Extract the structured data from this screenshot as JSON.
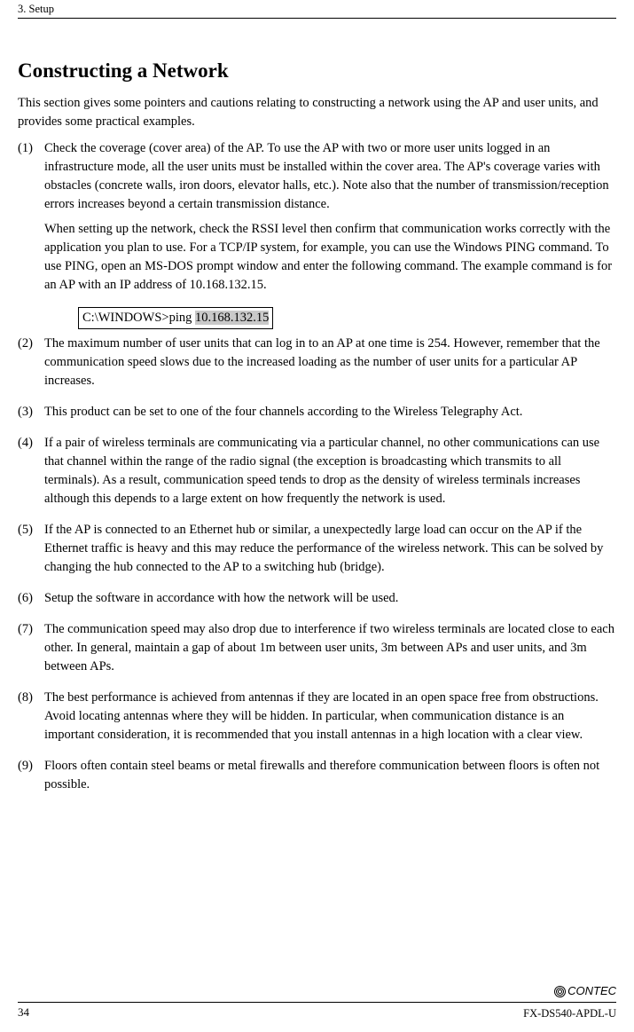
{
  "header": {
    "section": "3. Setup"
  },
  "heading": "Constructing a Network",
  "intro": "This section gives some pointers and cautions relating to constructing a network using the AP and user units, and provides some practical examples.",
  "items": [
    {
      "num": "(1)",
      "paras": [
        "Check the coverage (cover area) of the AP.  To use the AP with two or more user units logged in an infrastructure mode, all the user units must be installed within the cover area.  The AP's coverage varies with obstacles (concrete walls, iron doors, elevator halls, etc.).  Note also that the number of transmission/reception errors increases beyond a certain transmission distance.",
        "When setting up the network, check the RSSI level then confirm that communication works correctly with the application you plan to use.  For a TCP/IP system, for example, you can use the Windows PING command.  To use PING, open an MS-DOS prompt window and enter the following command.  The example command is for an AP with an IP address of 10.168.132.15."
      ]
    },
    {
      "num": "(2)",
      "paras": [
        "The maximum number of user units that can log in to an AP at one time is 254.  However, remember that the communication speed slows due to the increased loading as the number of user units for a particular AP increases."
      ]
    },
    {
      "num": "(3)",
      "paras": [
        "This product can be set to one of the four channels according to the Wireless Telegraphy Act."
      ]
    },
    {
      "num": "(4)",
      "paras": [
        "If a pair of wireless terminals are communicating via a particular channel, no other communications can use that channel within the range of the radio signal (the exception is broadcasting which transmits to all terminals).  As a result, communication speed tends to drop as the density of wireless terminals increases although this depends to a large extent on how frequently the network is used."
      ]
    },
    {
      "num": "(5)",
      "paras": [
        "If the AP is connected to an Ethernet hub or similar, a unexpectedly large load can occur on the AP if the Ethernet traffic is heavy and this may reduce the performance of the wireless network.  This can be solved by changing the hub connected to the AP to a switching hub (bridge)."
      ]
    },
    {
      "num": "(6)",
      "paras": [
        "Setup the software in accordance with how the network will be used."
      ]
    },
    {
      "num": "(7)",
      "paras": [
        "The communication speed may also drop due to interference if two wireless terminals are located close to each other.  In general, maintain a gap of about 1m between user units, 3m between APs and user units, and 3m between APs."
      ]
    },
    {
      "num": "(8)",
      "paras": [
        "The best performance is achieved from antennas if they are located in an open space free from obstructions.  Avoid locating antennas where they will be hidden.  In particular, when communication distance is an important consideration, it is recommended that you install antennas in a high location with a clear view."
      ]
    },
    {
      "num": "(9)",
      "paras": [
        "Floors often contain steel beams or metal firewalls and therefore communication between floors is often not possible."
      ]
    }
  ],
  "code": {
    "prefix": "C:\\WINDOWS>ping ",
    "highlight": "10.168.132.15"
  },
  "footer": {
    "page": "34",
    "brand": "CONTEC",
    "model": "FX-DS540-APDL-U"
  }
}
